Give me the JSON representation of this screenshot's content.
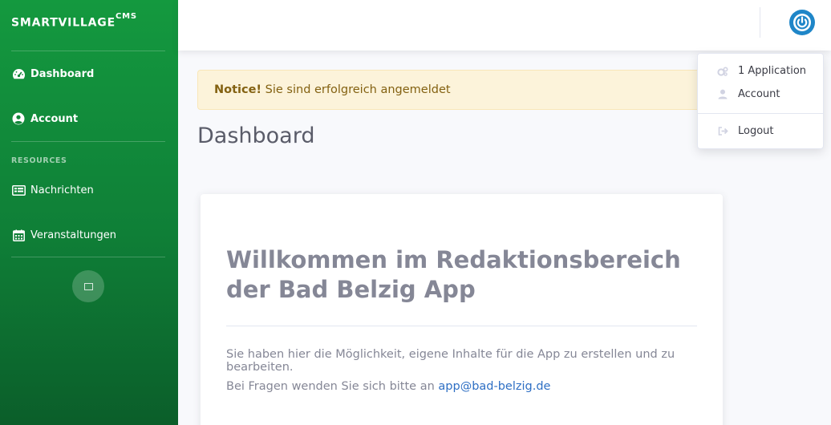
{
  "sidebar": {
    "brand": "SMARTVILLAGE",
    "brand_sup": "CMS",
    "items": [
      {
        "label": "Dashboard",
        "icon": "tachometer-icon"
      },
      {
        "label": "Account",
        "icon": "user-circle-icon"
      }
    ],
    "heading": "RESOURCES",
    "resources": [
      {
        "label": "Nachrichten",
        "icon": "newspaper-icon"
      },
      {
        "label": "Veranstaltungen",
        "icon": "calendar-icon"
      }
    ]
  },
  "notice": {
    "title": "Notice!",
    "text": "Sie sind erfolgreich angemeldet"
  },
  "page": {
    "title": "Dashboard"
  },
  "card": {
    "heading_line1": "Willkommen im Redaktionsbereich",
    "heading_line2": "der Bad Belzig App",
    "paragraph1": "Sie haben hier die Möglichkeit, eigene Inhalte für die App zu erstellen und zu bearbeiten.",
    "paragraph2_prefix": "Bei Fragen wenden Sie sich bitte an ",
    "email": "app@bad-belzig.de"
  },
  "dropdown": {
    "items": [
      {
        "label": "1 Application",
        "icon": "cogs-icon"
      },
      {
        "label": "Account",
        "icon": "user-icon"
      },
      {
        "label": "Logout",
        "icon": "sign-out-icon"
      }
    ]
  },
  "colors": {
    "sidebar_top": "#14993f",
    "sidebar_bottom": "#0b5e2a",
    "power_button": "#1f86c8",
    "link": "#2e6fc4"
  }
}
